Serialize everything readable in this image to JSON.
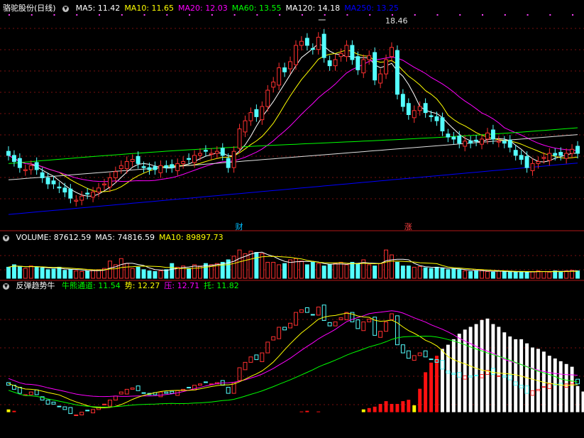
{
  "main_panel": {
    "title": "骆驼股份(日线)",
    "ma": [
      {
        "label": "MA5: 11.42",
        "color": "#ffffff"
      },
      {
        "label": "MA10: 11.65",
        "color": "#ffff00"
      },
      {
        "label": "MA20: 12.03",
        "color": "#ff00ff"
      },
      {
        "label": "MA60: 13.55",
        "color": "#00ff00"
      },
      {
        "label": "MA120: 14.18",
        "color": "#ffffff"
      },
      {
        "label": "MA250: 13.25",
        "color": "#0000ff"
      }
    ],
    "high_label": "18.46",
    "badges": [
      {
        "text": "财",
        "color": "#00bfff",
        "pos": 41
      },
      {
        "text": "涨",
        "color": "#ff4040",
        "pos": 71
      }
    ]
  },
  "volume_panel": {
    "items": [
      {
        "label": "VOLUME: 87612.59",
        "color": "#ffffff"
      },
      {
        "label": "MA5: 74816.59",
        "color": "#ffffff"
      },
      {
        "label": "MA10: 89897.73",
        "color": "#ffff00"
      }
    ]
  },
  "indicator_panel": {
    "title": "反弹趋势牛",
    "items": [
      {
        "label": "牛熊通道: 11.54",
        "color": "#00ff00"
      },
      {
        "label": "势: 12.27",
        "color": "#ffff00"
      },
      {
        "label": "压: 12.71",
        "color": "#ff00ff"
      },
      {
        "label": "托: 11.82",
        "color": "#00ff00"
      }
    ]
  },
  "colors": {
    "up": "#ff3030",
    "down": "#54ffff",
    "grid": "#7a1010",
    "ma5": "#ffffff",
    "ma10": "#ffff00",
    "ma20": "#ff00ff",
    "ma60": "#00ff00",
    "ma120": "#e0e0e0",
    "ma250": "#0000ff"
  },
  "chart_data": [
    {
      "type": "candlestick",
      "ylim": [
        9.2,
        19.2
      ],
      "closes": [
        12.2,
        11.9,
        11.6,
        11.5,
        11.7,
        11.5,
        11.1,
        10.8,
        10.8,
        10.6,
        10.4,
        10.1,
        10.0,
        10.2,
        10.3,
        10.4,
        10.6,
        10.8,
        11.1,
        11.4,
        11.7,
        11.9,
        12.0,
        11.8,
        11.6,
        11.5,
        11.5,
        11.7,
        11.6,
        11.6,
        11.8,
        11.9,
        12.0,
        12.2,
        12.3,
        12.4,
        12.3,
        12.4,
        12.2,
        11.6,
        12.4,
        13.5,
        13.9,
        14.3,
        14.1,
        14.6,
        15.4,
        15.8,
        16.5,
        16.3,
        16.8,
        17.6,
        17.8,
        17.6,
        17.4,
        18.0,
        17.0,
        16.6,
        16.9,
        17.2,
        17.6,
        16.9,
        16.4,
        16.9,
        17.1,
        15.9,
        16.2,
        16.9,
        17.5,
        15.2,
        14.6,
        14.2,
        14.4,
        14.6,
        14.3,
        14.1,
        13.9,
        13.4,
        13.1,
        13.0,
        12.8,
        12.9,
        12.8,
        12.9,
        13.0,
        13.3,
        13.0,
        12.9,
        12.8,
        12.6,
        12.2,
        12.0,
        11.6,
        11.8,
        11.9,
        12.1,
        12.3,
        12.2,
        12.2,
        12.3,
        12.5,
        12.3
      ]
    },
    {
      "type": "bar",
      "name": "VOLUME",
      "ylim": [
        0,
        300000
      ],
      "values": [
        90000,
        110000,
        95000,
        80000,
        100000,
        90000,
        85000,
        70000,
        75000,
        90000,
        65000,
        70000,
        60000,
        55000,
        60000,
        65000,
        70000,
        80000,
        140000,
        110000,
        160000,
        120000,
        80000,
        90000,
        70000,
        60000,
        55000,
        60000,
        70000,
        120000,
        90000,
        100000,
        80000,
        110000,
        100000,
        120000,
        110000,
        120000,
        130000,
        150000,
        180000,
        230000,
        200000,
        220000,
        210000,
        200000,
        130000,
        130000,
        110000,
        120000,
        150000,
        160000,
        140000,
        110000,
        130000,
        120000,
        100000,
        110000,
        120000,
        130000,
        110000,
        130000,
        120000,
        150000,
        110000,
        100000,
        120000,
        230000,
        190000,
        130000,
        100000,
        100000,
        90000,
        95000,
        85000,
        80000,
        90000,
        80000,
        70000,
        75000,
        70000,
        60000,
        55000,
        60000,
        65000,
        55000,
        50000,
        60000,
        55000,
        50000,
        50000,
        55000,
        50000,
        55000,
        60000,
        55000,
        50000,
        60000,
        55000,
        60000,
        65000,
        60000
      ]
    },
    {
      "type": "bar",
      "name": "势",
      "ylim": [
        9.0,
        18.8
      ],
      "values": [
        10.2,
        10.1,
        0,
        0,
        0,
        0,
        0,
        0,
        0,
        0,
        0,
        0,
        0,
        0,
        0,
        0,
        0,
        0,
        0,
        0,
        0,
        0,
        0,
        0,
        0,
        0,
        0,
        0,
        0,
        0,
        0,
        0,
        0,
        0,
        0,
        0,
        0,
        0,
        0,
        0,
        0,
        0,
        0,
        0,
        0,
        0,
        0,
        0,
        0,
        0,
        10.0,
        10.0,
        10.05,
        10.1,
        10.0,
        10.05,
        10.0,
        10.0,
        10.0,
        10.0,
        10.0,
        10.0,
        10.0,
        10.2,
        10.3,
        10.4,
        10.6,
        10.8,
        10.6,
        10.6,
        10.8,
        10.9,
        10.5,
        11.7,
        12.9,
        13.6,
        14.1,
        14.6,
        14.9,
        15.3,
        15.7,
        16.0,
        16.2,
        16.4,
        16.7,
        16.8,
        16.4,
        16.2,
        15.8,
        15.5,
        15.3,
        15.3,
        15.0,
        14.7,
        14.6,
        14.4,
        14.1,
        13.9,
        13.7,
        13.5,
        13.3,
        11.9,
        11.5,
        10.3,
        10.0,
        10.0
      ]
    }
  ]
}
